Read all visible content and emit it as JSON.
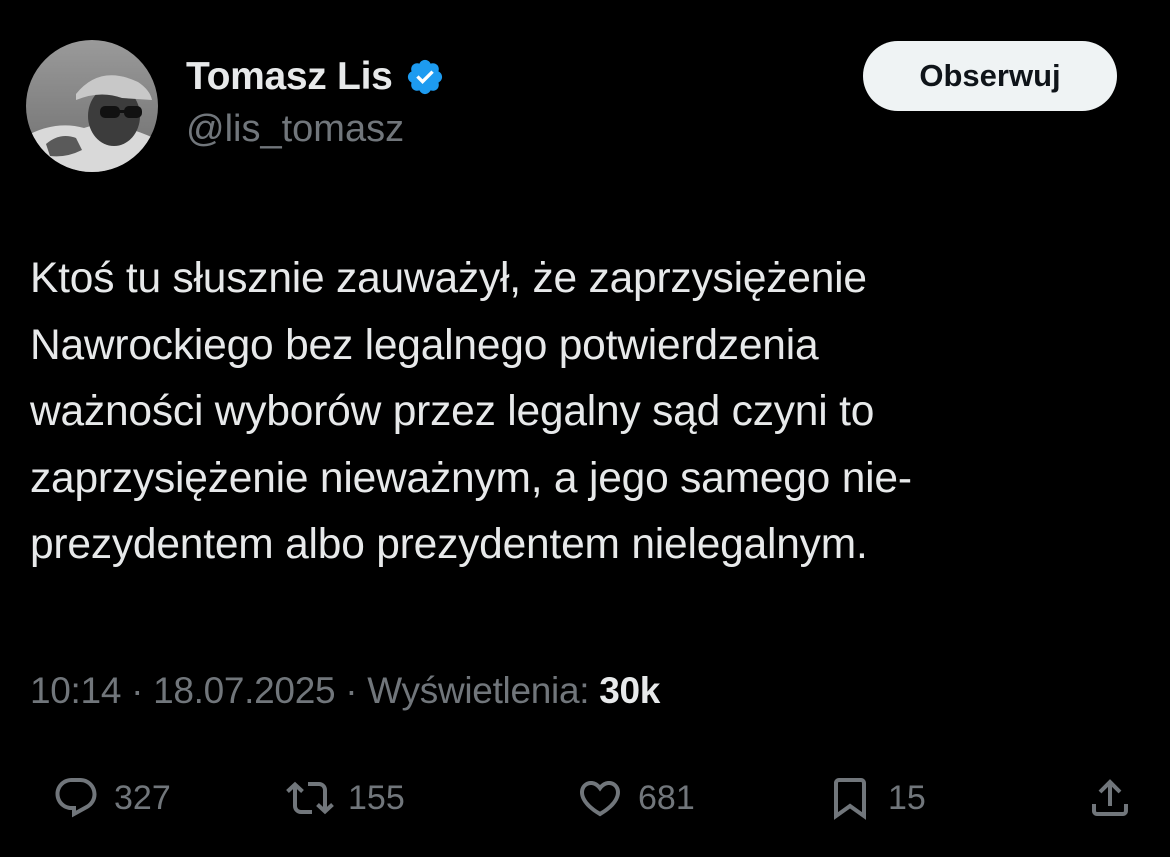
{
  "tweet": {
    "author": {
      "display_name": "Tomasz Lis",
      "handle": "@lis_tomasz",
      "verified": true,
      "avatar_icon": "profile-photo"
    },
    "follow_label": "Obserwuj",
    "text_lines": [
      "Ktoś tu słusznie zauważył, że zaprzysiężenie",
      "Nawrockiego bez legalnego potwierdzenia",
      "ważności wyborów przez legalny sąd czyni to",
      "zaprzysiężenie nieważnym, a jego samego nie-",
      "prezydentem albo prezydentem nielegalnym."
    ],
    "meta": {
      "time": "10:14",
      "separator": " · ",
      "date": "18.07.2025",
      "views_label": "Wyświetlenia:",
      "views_count": "30k"
    },
    "actions": {
      "replies": {
        "icon": "reply-icon",
        "count": "327"
      },
      "reposts": {
        "icon": "repost-icon",
        "count": "155"
      },
      "likes": {
        "icon": "heart-icon",
        "count": "681"
      },
      "bookmarks": {
        "icon": "bookmark-icon",
        "count": "15"
      },
      "share": {
        "icon": "share-icon"
      }
    }
  },
  "colors": {
    "background": "#000000",
    "text_primary": "#e7e9ea",
    "text_secondary": "#71767b",
    "verified_blue": "#1d9bf0",
    "follow_button_bg": "#eff3f4",
    "follow_button_text": "#0f1419"
  }
}
